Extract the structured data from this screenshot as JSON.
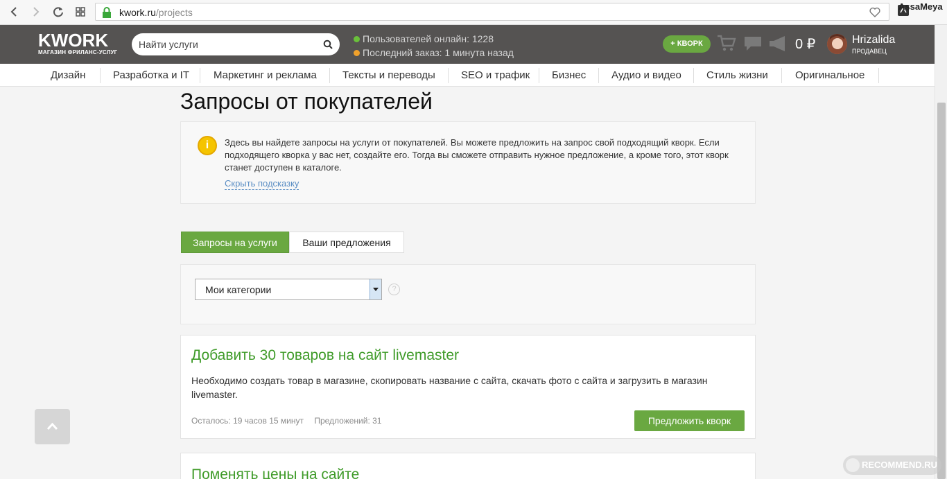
{
  "browser": {
    "url_host": "kwork.ru",
    "url_path": "/projects",
    "corner_user": "AssaMeya"
  },
  "header": {
    "logo": "KWORK",
    "logo_sub": "МАГАЗИН ФРИЛАНС-УСЛУГ",
    "search_placeholder": "Найти услуги",
    "online_label": "Пользователей онлайн: 1228",
    "last_order_label": "Последний заказ: 1 минута назад",
    "add_kwork": "КВОРК",
    "balance": "0 ₽",
    "user_name": "Hrizalida",
    "user_role": "ПРОДАВЕЦ",
    "colors": {
      "online": "#6ac13b",
      "last_order": "#f0a12b",
      "accent": "#6aa841"
    }
  },
  "categories": [
    "Дизайн",
    "Разработка и IT",
    "Маркетинг и реклама",
    "Тексты и переводы",
    "SEO и трафик",
    "Бизнес",
    "Аудио и видео",
    "Стиль жизни",
    "Оригинальное"
  ],
  "page": {
    "title": "Запросы от покупателей",
    "hint": {
      "text": "Здесь вы найдете запросы на услуги от покупателей. Вы можете предложить на запрос свой подходящий кворк. Если подходящего кворка у вас нет, создайте его. Тогда вы сможете отправить нужное предложение, а кроме того, этот кворк станет доступен в каталоге.",
      "hide_link": "Скрыть подсказку"
    },
    "tabs": [
      {
        "label": "Запросы на услуги",
        "active": true
      },
      {
        "label": "Ваши предложения",
        "active": false
      }
    ],
    "filter": {
      "selected": "Мои категории",
      "help": "?"
    },
    "requests": [
      {
        "title": "Добавить 30 товаров на сайт livemaster",
        "description": "Необходимо создать товар в магазине, скопировать название с сайта, скачать фото с сайта и загрузить в магазин livemaster.",
        "remaining": "Осталось: 19 часов 15 минут",
        "offers": "Предложений: 31",
        "offer_button": "Предложить кворк"
      },
      {
        "title": "Поменять цены на сайте"
      }
    ]
  },
  "watermark": "RECOMMEND.RU"
}
